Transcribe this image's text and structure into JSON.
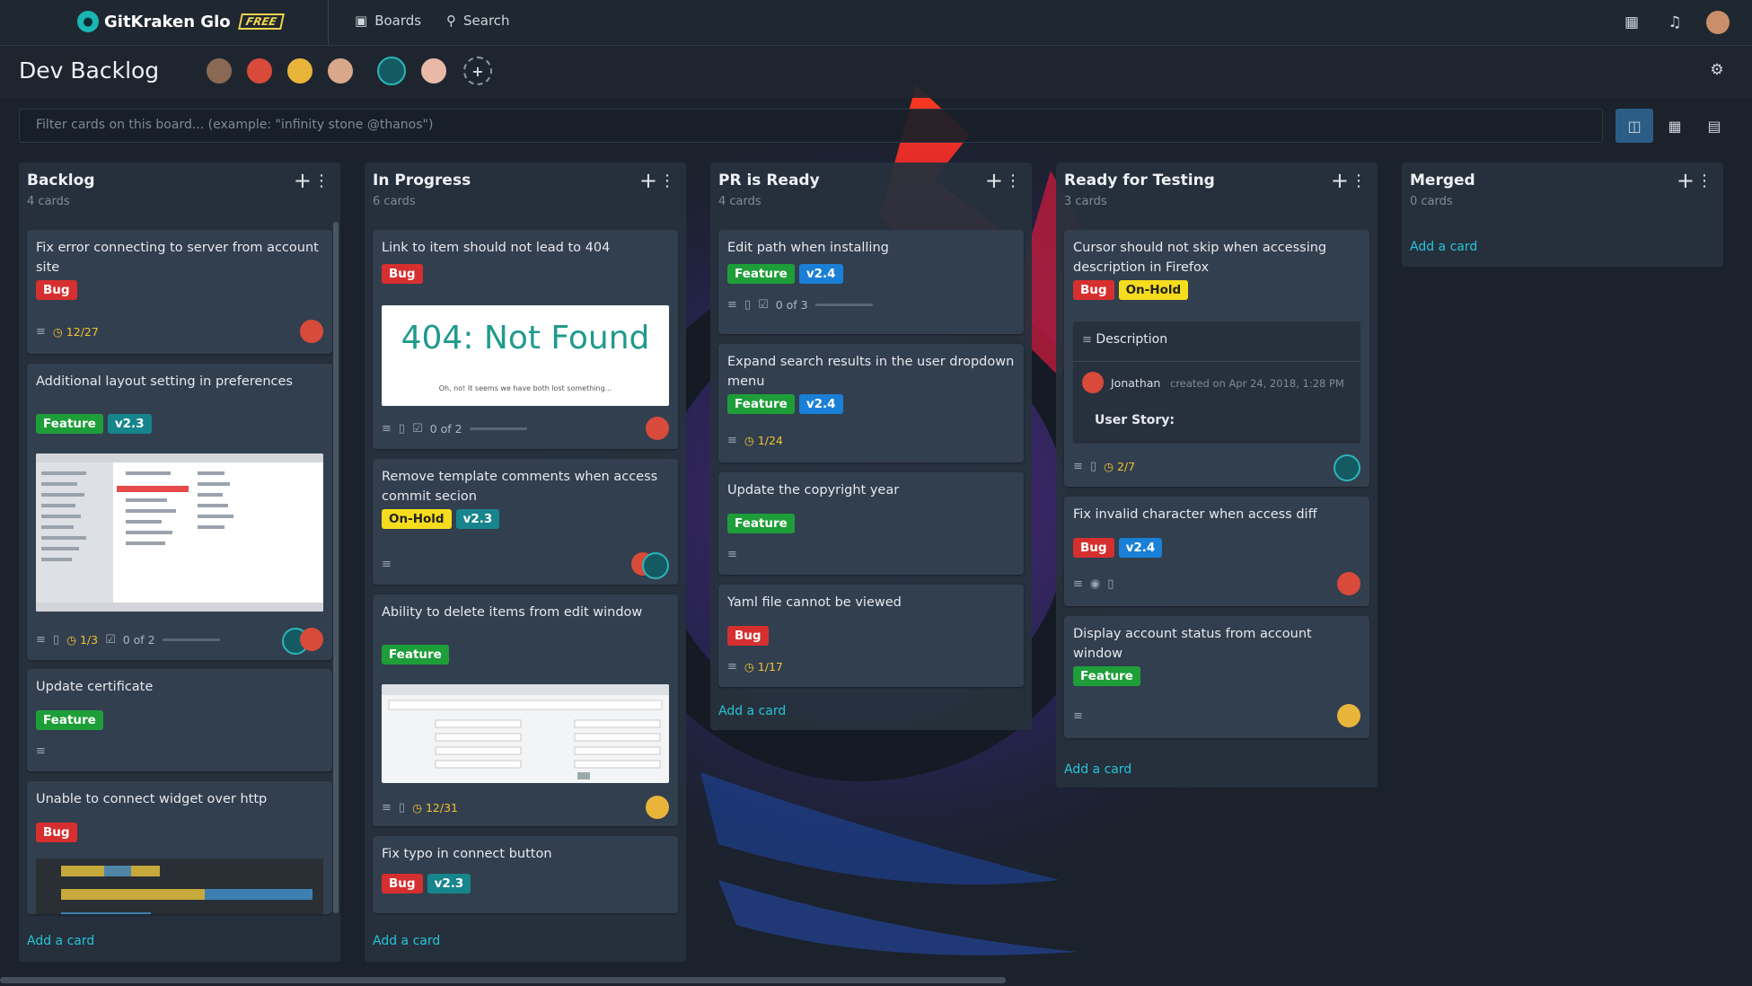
{
  "app": {
    "logo_text": "GitKraken Glo",
    "plan_badge": "FREE",
    "nav": {
      "boards": "Boards",
      "search": "Search"
    }
  },
  "board": {
    "title": "Dev Backlog",
    "filter_placeholder": "Filter cards on this board... (example: \"infinity stone @thanos\")"
  },
  "columns": [
    {
      "name": "Backlog",
      "count": "4 cards",
      "add_card": "Add a card",
      "cards": [
        {
          "title": "Fix error connecting to server from account site",
          "labels": [
            "Bug"
          ],
          "due": "12/27"
        },
        {
          "title": "Additional layout setting in preferences",
          "labels": [
            "Feature",
            "v2.3"
          ],
          "due": "1/3",
          "checklist": "0 of 2"
        },
        {
          "title": "Update certificate",
          "labels": [
            "Feature"
          ]
        },
        {
          "title": "Unable to connect widget over http",
          "labels": [
            "Bug"
          ]
        }
      ]
    },
    {
      "name": "In Progress",
      "count": "6 cards",
      "add_card": "Add a card",
      "cards": [
        {
          "title": "Link to item should not lead to 404",
          "labels": [
            "Bug"
          ],
          "image_heading": "404: Not Found",
          "image_caption": "Oh, no! It seems we have both lost something...",
          "checklist": "0 of 2"
        },
        {
          "title": "Remove template comments when access commit secion",
          "labels": [
            "On-Hold",
            "v2.3"
          ]
        },
        {
          "title": "Ability to delete items from edit window",
          "labels": [
            "Feature"
          ],
          "due": "12/31"
        },
        {
          "title": "Fix typo in connect button",
          "labels": [
            "Bug",
            "v2.3"
          ]
        }
      ]
    },
    {
      "name": "PR is Ready",
      "count": "4 cards",
      "add_card": "Add a card",
      "cards": [
        {
          "title": "Edit path when installing",
          "labels": [
            "Feature",
            "v2.4"
          ],
          "checklist": "0 of 3"
        },
        {
          "title": "Expand search results in the user dropdown menu",
          "labels": [
            "Feature",
            "v2.4"
          ],
          "due": "1/24"
        },
        {
          "title": "Update the copyright year",
          "labels": [
            "Feature"
          ]
        },
        {
          "title": "Yaml file cannot be viewed",
          "labels": [
            "Bug"
          ],
          "due": "1/17"
        }
      ]
    },
    {
      "name": "Ready for Testing",
      "count": "3 cards",
      "add_card": "Add a card",
      "cards": [
        {
          "title": "Cursor should not skip when accessing description in Firefox",
          "labels": [
            "Bug",
            "On-Hold"
          ],
          "description_heading": "Description",
          "author": "Jonathan",
          "created": "created on Apr 24, 2018, 1:28 PM",
          "story": "User Story:",
          "due": "2/7"
        },
        {
          "title": "Fix invalid character when access diff",
          "labels": [
            "Bug",
            "v2.4"
          ]
        },
        {
          "title": "Display account status from account window",
          "labels": [
            "Feature"
          ]
        }
      ]
    },
    {
      "name": "Merged",
      "count": "0 cards",
      "add_card": "Add a card",
      "cards": []
    }
  ],
  "colors": {
    "bug": "#d62f2f",
    "feature": "#1e9e39",
    "v23": "#17858c",
    "v24": "#1a7fd6",
    "onhold": "#f5dc1c",
    "link": "#25c4d6"
  }
}
